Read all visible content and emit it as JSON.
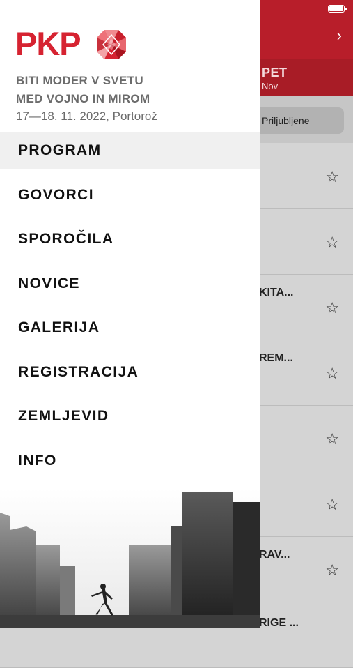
{
  "drawer": {
    "logo_text": "PKP",
    "tagline_1": "BITI MODER V SVETU",
    "tagline_2": "MED VOJNO IN MIROM",
    "date_location": "17—18. 11. 2022, Portorož",
    "menu": [
      {
        "label": "PROGRAM",
        "active": true
      },
      {
        "label": "GOVORCI"
      },
      {
        "label": "SPOROČILA"
      },
      {
        "label": "NOVICE"
      },
      {
        "label": "GALERIJA"
      },
      {
        "label": "REGISTRACIJA"
      },
      {
        "label": "ZEMLJEVID"
      },
      {
        "label": "INFO"
      }
    ]
  },
  "background": {
    "day_name": "PET",
    "day_month": "Nov",
    "favorites_filter": "Priljubljene",
    "sessions": [
      "",
      "",
      "KITA...",
      "REM...",
      "",
      "",
      "RAV...",
      "RIGE ..."
    ],
    "nav_chevron": "›",
    "star_glyph": "☆"
  },
  "colors": {
    "brand_red": "#d62331",
    "top_bar": "#b81e2a",
    "day_tab": "#a81c26"
  },
  "icons": [
    "battery-icon",
    "chevron-right-icon",
    "star-icon",
    "pkp-logo-mark"
  ]
}
